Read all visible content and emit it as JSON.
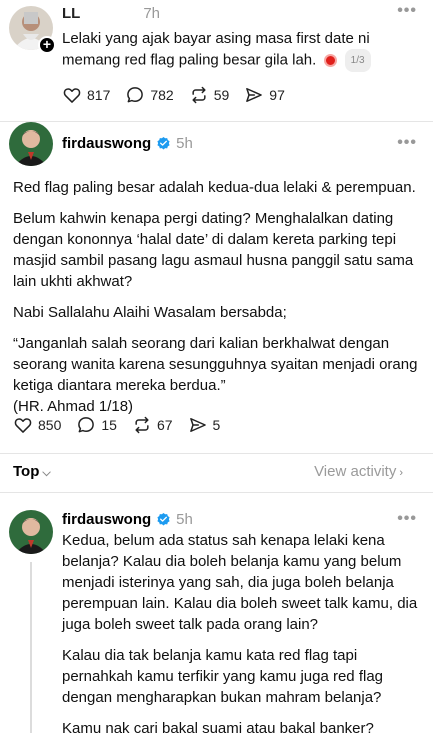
{
  "post_top": {
    "username": "LL",
    "time": "7h",
    "text": "Lelaki yang ajak bayar asing masa first date ni memang red flag paling besar gila lah.",
    "counter": "1/3",
    "likes": "817",
    "comments": "782",
    "reposts": "59",
    "shares": "97"
  },
  "post_main": {
    "username": "firdauswong",
    "time": "5h",
    "paragraphs": [
      "Red flag paling besar adalah kedua-dua lelaki & perempuan.",
      "Belum kahwin kenapa pergi dating? Menghalalkan dating dengan kononnya ‘halal date’ di dalam kereta parking tepi masjid sambil pasang lagu asmaul husna panggil satu sama lain ukhti akhwat?",
      "Nabi Sallalahu Alaihi Wasalam bersabda;",
      "“Janganlah salah seorang dari kalian berkhalwat dengan seorang wanita karena sesungguhnya syaitan menjadi orang ketiga diantara mereka berdua.”",
      "(HR. Ahmad 1/18)"
    ],
    "likes": "850",
    "comments": "15",
    "reposts": "67",
    "shares": "5"
  },
  "sort": {
    "label": "Top",
    "view_activity": "View activity"
  },
  "reply": {
    "username": "firdauswong",
    "time": "5h",
    "paragraphs": [
      "Kedua, belum ada status sah kenapa lelaki kena belanja? Kalau dia boleh belanja kamu yang belum menjadi isterinya yang sah, dia juga boleh belanja perempuan lain. Kalau dia boleh sweet talk kamu, dia juga boleh sweet talk pada orang lain?",
      "Kalau dia tak belanja kamu kata red flag tapi pernahkah kamu terfikir yang kamu juga red flag dengan mengharapkan bukan mahram belanja?",
      "Kamu nak cari bakal suami atau bakal banker?"
    ]
  },
  "colors": {
    "verified": "#1d9bf0",
    "muted": "#999999",
    "red": "#e0201b"
  }
}
